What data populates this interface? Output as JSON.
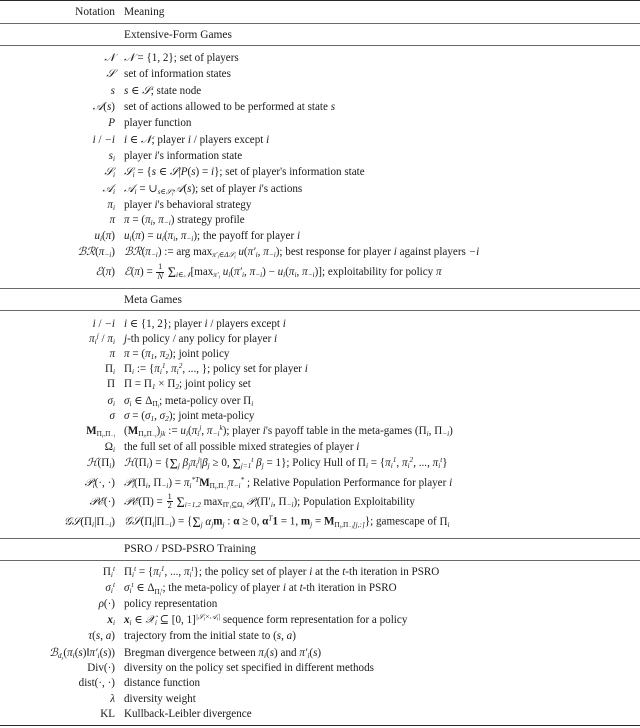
{
  "table": {
    "columns": [
      "Notation",
      "Meaning"
    ],
    "sections": [
      {
        "title": "Extensive-Form Games",
        "rows": [
          {
            "notation": "𝒩",
            "meaning": "𝒩 = {1, 2}; set of players"
          },
          {
            "notation": "𝒮",
            "meaning": "set of information states"
          },
          {
            "notation": "s",
            "meaning": "s ∈ 𝒮; state node"
          },
          {
            "notation": "𝒜(s)",
            "meaning": "set of actions allowed to be performed at state s"
          },
          {
            "notation": "P",
            "meaning": "player function"
          },
          {
            "notation": "i / −i",
            "meaning": "i ∈ 𝒩; player i / players except i"
          },
          {
            "notation": "s_i",
            "meaning": "player i's information state"
          },
          {
            "notation": "𝒮_i",
            "meaning": "𝒮_i = {s ∈ 𝒮|P(s) = i}; set of player's information state"
          },
          {
            "notation": "𝒜_i",
            "meaning": "𝒜_i = ∪_{s∈𝒮_i}𝒜(s); set of player i's actions"
          },
          {
            "notation": "π_i",
            "meaning": "player i's behavioral strategy"
          },
          {
            "notation": "π",
            "meaning": "π = (π_i, π_−i) strategy profile"
          },
          {
            "notation": "u_i(π)",
            "meaning": "u_i(π) = u_i(π_i, π_−i); the payoff for player i"
          },
          {
            "notation": "ℬℛ(π_−i)",
            "meaning": "ℬℛ(π_−i) := arg max_{π'_i∈Δ𝒮_i} u(π'_i, π_−i); best response for player i against players −i"
          },
          {
            "notation": "ℰ(π)",
            "meaning": "ℰ(π) = 1/N Σ_{i∈𝒩}[max_{π'_i} u_i(π'_i, π_−i) − u_i(π_i, π_−i)]; exploitability for policy π"
          }
        ]
      },
      {
        "title": "Meta Games",
        "rows": [
          {
            "notation": "i / −i",
            "meaning": "i ∈ {1, 2}; player i / players except i"
          },
          {
            "notation": "π_i^j / π_i",
            "meaning": "j-th policy / any policy for player i"
          },
          {
            "notation": "π",
            "meaning": "π = (π_1, π_2); joint policy"
          },
          {
            "notation": "Π_i",
            "meaning": "Π_i := {π_i^1, π_i^2, ..., }; policy set for player i"
          },
          {
            "notation": "Π",
            "meaning": "Π = Π_1 × Π_2; joint policy set"
          },
          {
            "notation": "σ_i",
            "meaning": "σ_i ∈ Δ_{Π_i}; meta-policy over Π_i"
          },
          {
            "notation": "σ",
            "meaning": "σ = (σ_1, σ_2); joint meta-policy"
          },
          {
            "notation": "M_{Π_i,Π_−i}",
            "meaning": "(M_{Π_i,Π_−i})_{jk} := u_i(π_i^j, π_−i^k); player i's payoff table in the meta-games (Π_i, Π_−i)"
          },
          {
            "notation": "Ω_i",
            "meaning": "the full set of all possible mixed strategies of player i"
          },
          {
            "notation": "ℋ(Π_i)",
            "meaning": "ℋ(Π_i) = {Σ_j β_jπ_i^j|β_j ≥ 0, Σ_{j=1}^t β_j = 1}; Policy Hull of Π_i = {π_i^1, π_i^2, ..., π_i^t}"
          },
          {
            "notation": "𝒫_i(·,·)",
            "meaning": "𝒫_i(Π_i, Π_−i) = π_i^{*T}M_{Π_i,Π_−i}π_−i^*; Relative Population Performance for player i"
          },
          {
            "notation": "𝒫ℰ(·)",
            "meaning": "𝒫ℰ(Π) = 1/2 Σ_{i=1,2} max_{Π'_i⊆Ω_i} 𝒫_i(Π'_i, Π_−i); Population Exploitability"
          },
          {
            "notation": "𝒢𝒮(Π_i|Π_−i)",
            "meaning": "𝒢𝒮(Π_i|Π_−i) = {Σ_j α_jm_j : α ≥ 0, α^T1 = 1, m_j = M_{Π_i,Π_−i[j,:]}}; gamescape of Π_i"
          }
        ]
      },
      {
        "title": "PSRO / PSD-PSRO Training",
        "rows": [
          {
            "notation": "Π_i^t",
            "meaning": "Π_i^t = {π_i^1, ..., π_i^t}; the policy set of player i at the t-th iteration in PSRO"
          },
          {
            "notation": "σ_i^t",
            "meaning": "σ_i^t ∈ Δ_{Π_i^t}; the meta-policy of player i at t-th iteration in PSRO"
          },
          {
            "notation": "ρ(·)",
            "meaning": "policy representation"
          },
          {
            "notation": "x_i",
            "meaning": "x_i ∈ 𝒳_i ⊆ [0, 1]^{|𝒮_i×𝒜_i|} sequence form representation for a policy"
          },
          {
            "notation": "τ(s, a)",
            "meaning": "trajectory from the initial state to (s, a)"
          },
          {
            "notation": "ℬ_{d_s}(π_i(s)‖π'_i(s))",
            "meaning": "Bregman divergence between π_i(s) and π'_i(s)"
          },
          {
            "notation": "Div(·)",
            "meaning": "diversity on the policy set specified in different methods"
          },
          {
            "notation": "dist(·, ·)",
            "meaning": "distance function"
          },
          {
            "notation": "λ",
            "meaning": "diversity weight"
          },
          {
            "notation": "KL",
            "meaning": "Kullback-Leibler divergence"
          }
        ]
      }
    ]
  }
}
